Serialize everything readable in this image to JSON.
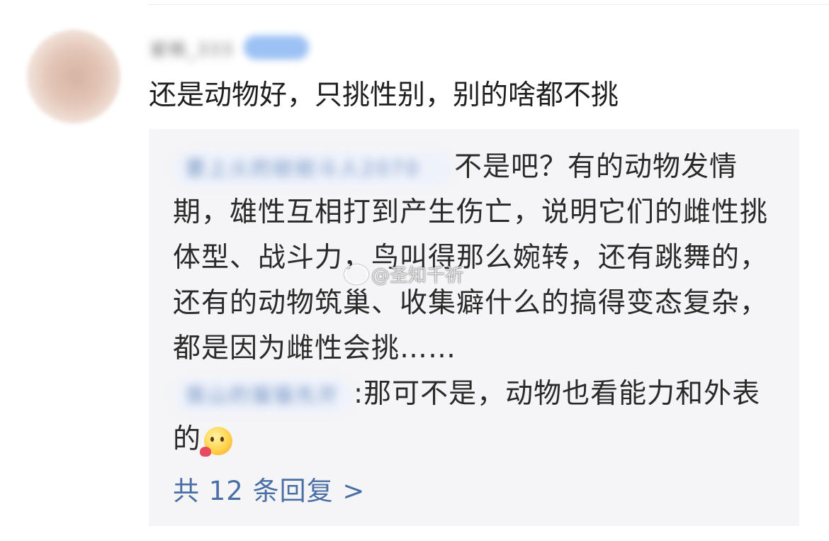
{
  "comment": {
    "username": "翟楠_333",
    "text": "还是动物好，只挑性别，别的啥都不挑"
  },
  "replies": [
    {
      "author": "要上火的蚊蚊斗人2070",
      "text": "不是吧？有的动物发情期，雄性互相打到产生伤亡，说明它们的雌性挑体型、战斗力，鸟叫得那么婉转，还有跳舞的，还有的动物筑巢、收集癖什么的搞得变态复杂，都是因为雌性会挑……"
    },
    {
      "author": "我山的猫猫先开",
      "separator": ":",
      "text": "那可不是，动物也看能力和外表的",
      "emoji": "heart-smile-emoji"
    }
  ],
  "more_replies": "共 12 条回复 >",
  "watermark": "@圣知千祈",
  "colors": {
    "link": "#4a6fa5",
    "reply_background": "#f5f5f7"
  }
}
